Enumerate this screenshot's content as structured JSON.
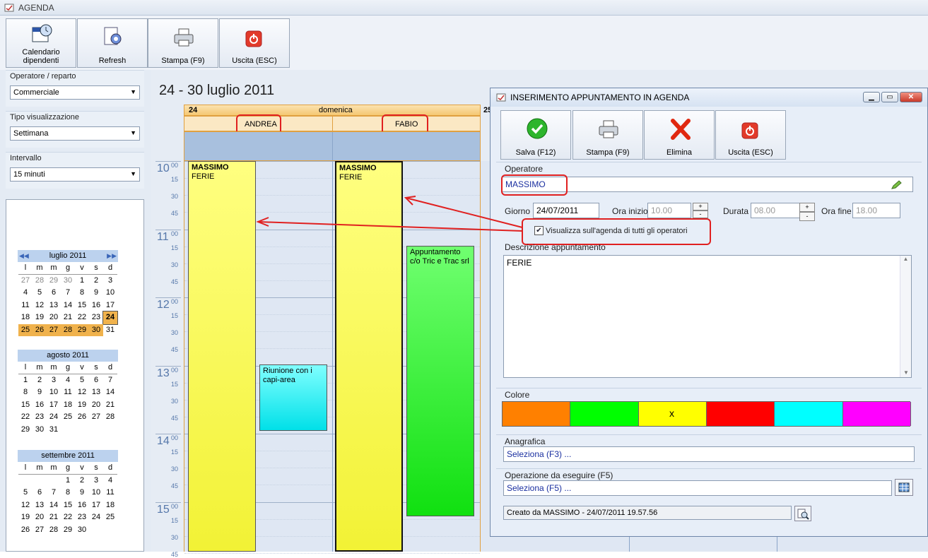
{
  "app": {
    "title": "AGENDA"
  },
  "toolbar": {
    "calendar_label": "Calendario dipendenti",
    "refresh_label": "Refresh",
    "print_label": "Stampa (F9)",
    "exit_label": "Uscita (ESC)"
  },
  "sidebar": {
    "operator_caption": "Operatore / reparto",
    "operator_value": "Commerciale",
    "view_caption": "Tipo visualizzazione",
    "view_value": "Settimana",
    "interval_caption": "Intervallo",
    "interval_value": "15 minuti",
    "weekdays": [
      "l",
      "m",
      "m",
      "g",
      "v",
      "s",
      "d"
    ],
    "months": [
      {
        "name": "luglio 2011",
        "days": [
          "27",
          "28",
          "29",
          "30",
          "1",
          "2",
          "3",
          "4",
          "5",
          "6",
          "7",
          "8",
          "9",
          "10",
          "11",
          "12",
          "13",
          "14",
          "15",
          "16",
          "17",
          "18",
          "19",
          "20",
          "21",
          "22",
          "23",
          "24",
          "25",
          "26",
          "27",
          "28",
          "29",
          "30",
          "31"
        ]
      },
      {
        "name": "agosto 2011",
        "days": [
          "1",
          "2",
          "3",
          "4",
          "5",
          "6",
          "7",
          "8",
          "9",
          "10",
          "11",
          "12",
          "13",
          "14",
          "15",
          "16",
          "17",
          "18",
          "19",
          "20",
          "21",
          "22",
          "23",
          "24",
          "25",
          "26",
          "27",
          "28",
          "29",
          "30",
          "31"
        ]
      },
      {
        "name": "settembre 2011",
        "days": [
          "1",
          "2",
          "3",
          "4",
          "5",
          "6",
          "7",
          "8",
          "9",
          "10",
          "11",
          "12",
          "13",
          "14",
          "15",
          "16",
          "17",
          "18",
          "19",
          "20",
          "21",
          "22",
          "23",
          "24",
          "25",
          "26",
          "27",
          "28",
          "29",
          "30"
        ]
      }
    ]
  },
  "schedule": {
    "week_title": "24 - 30 luglio 2011",
    "day_num": "24",
    "day_name": "domenica",
    "next_day_num": "25",
    "operators": [
      "ANDREA",
      "FABIO"
    ],
    "hours": [
      {
        "h": "10",
        "m": "00"
      },
      {
        "h": "11",
        "m": "00"
      },
      {
        "h": "12",
        "m": "00"
      },
      {
        "h": "13",
        "m": "00"
      },
      {
        "h": "14",
        "m": "00"
      },
      {
        "h": "15",
        "m": "00"
      }
    ],
    "quarters": [
      "15",
      "30",
      "45"
    ],
    "events": {
      "e1_title": "MASSIMO",
      "e1_sub": "FERIE",
      "e2_title": "MASSIMO",
      "e2_sub": "FERIE",
      "e3_text": "Riunione con i capi-area",
      "e4_text": "Appuntamento c/o Tric e Trac srl"
    }
  },
  "dialog": {
    "title": "INSERIMENTO APPUNTAMENTO IN AGENDA",
    "save_label": "Salva (F12)",
    "print_label": "Stampa (F9)",
    "delete_label": "Elimina",
    "exit_label": "Uscita (ESC)",
    "operator_caption": "Operatore",
    "operator_value": "MASSIMO",
    "day_label": "Giorno :",
    "day_value": "24/07/2011",
    "start_label": "Ora inizio :",
    "start_value": "10.00",
    "duration_label": "Durata :",
    "duration_value": "08.00",
    "end_label": "Ora fine :",
    "end_value": "18.00",
    "checkbox_label": "Visualizza sull'agenda di tutti gli operatori",
    "desc_caption": "Descrizione appuntamento",
    "desc_value": "FERIE",
    "color_caption": "Colore",
    "color_mark": "x",
    "colors": [
      "#ff8000",
      "#00ff00",
      "#ffff00",
      "#ff0000",
      "#00ffff",
      "#ff00ff"
    ],
    "anag_caption": "Anagrafica",
    "anag_value": "Seleziona (F3) ...",
    "op_caption": "Operazione da eseguire (F5)",
    "op_value": "Seleziona (F5) ...",
    "created_value": "Creato da MASSIMO - 24/07/2011 19.57.56"
  }
}
